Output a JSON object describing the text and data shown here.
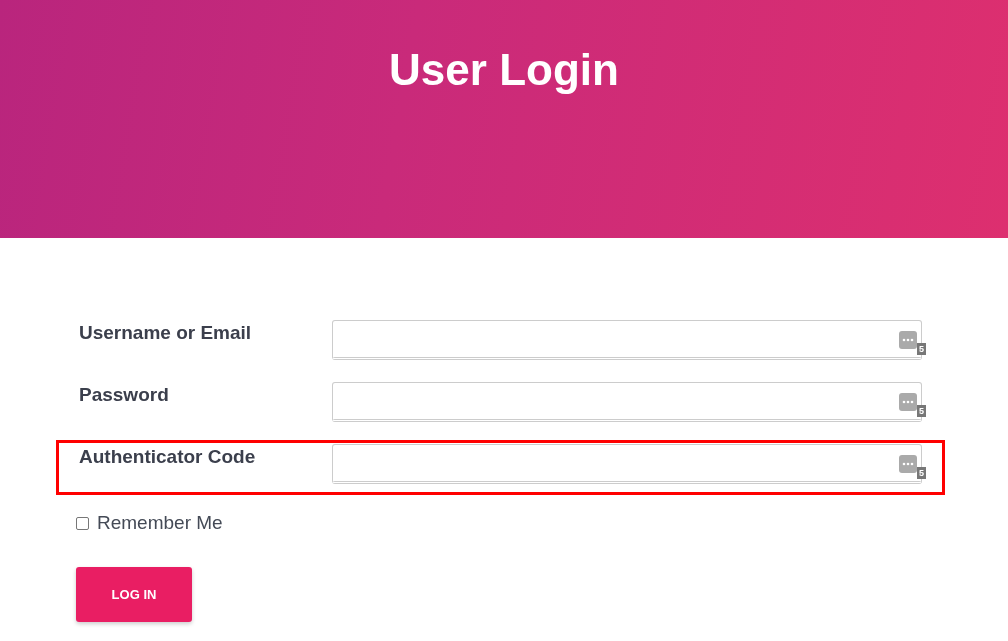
{
  "header": {
    "title": "User Login"
  },
  "fields": [
    {
      "label": "Username or Email",
      "badge": "5",
      "highlighted": false
    },
    {
      "label": "Password",
      "badge": "5",
      "highlighted": false
    },
    {
      "label": "Authenticator Code",
      "badge": "5",
      "highlighted": true
    }
  ],
  "remember": {
    "label": "Remember Me",
    "checked": false
  },
  "button": "LOG IN"
}
